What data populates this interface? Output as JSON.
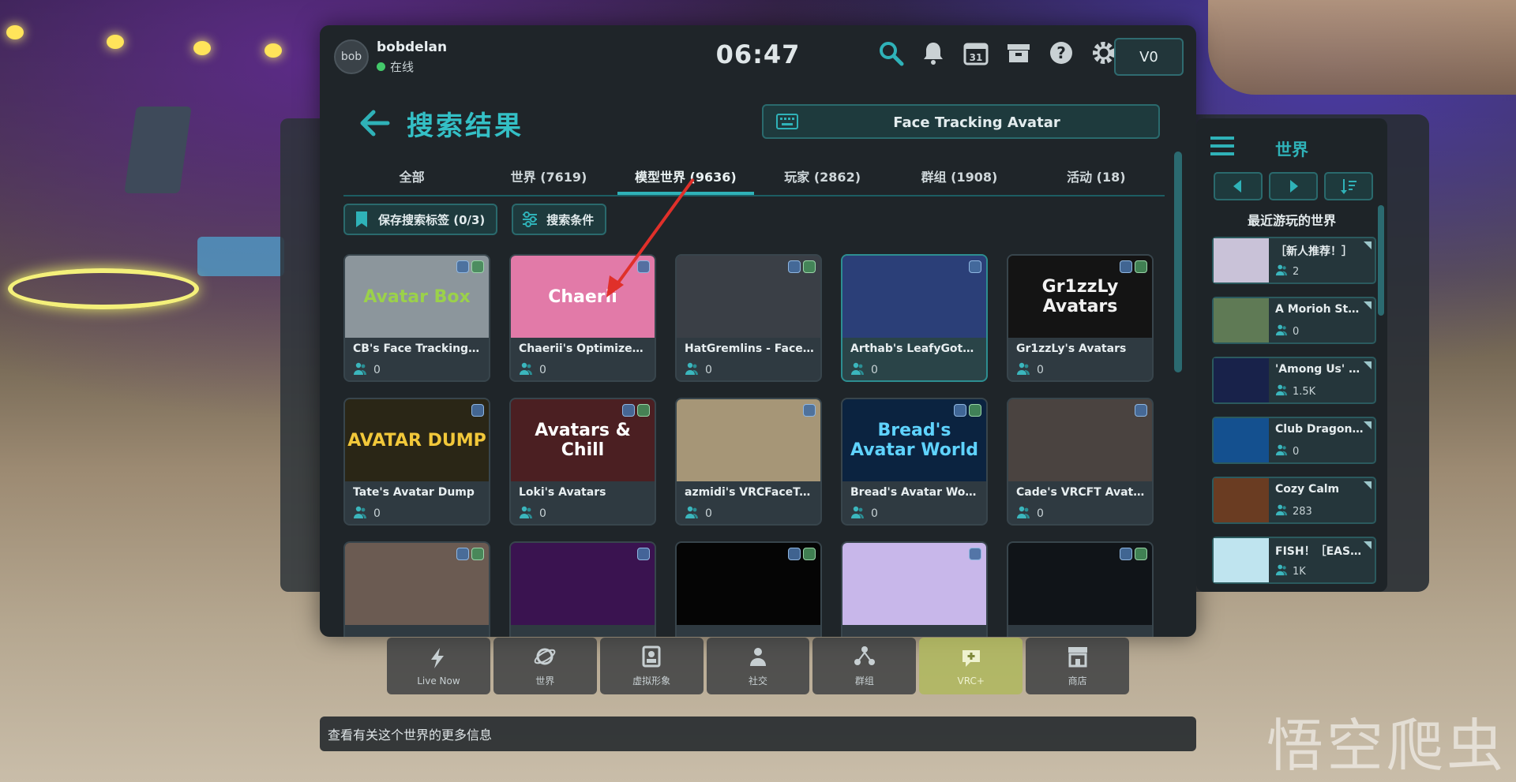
{
  "user": {
    "avatar_initials": "bob",
    "name": "bobdelan",
    "status": "在线"
  },
  "clock": "06:47",
  "credits": "V0",
  "header": {
    "title": "搜索结果",
    "search_value": "Face Tracking Avatar"
  },
  "tabs": [
    {
      "label": "全部"
    },
    {
      "label": "世界 (7619)"
    },
    {
      "label": "模型世界 (9636)"
    },
    {
      "label": "玩家 (2862)"
    },
    {
      "label": "群组 (1908)"
    },
    {
      "label": "活动 (18)"
    }
  ],
  "filters": {
    "save_tags": "保存搜索标签 (0/3)",
    "search_conditions": "搜索条件"
  },
  "results": [
    {
      "thumb_text": "Avatar Box",
      "name": "CB's Face Tracking Av...",
      "count": "0",
      "bg": "#8c969c",
      "fg": "#9bd14a"
    },
    {
      "thumb_text": "Chaerii",
      "name": "Chaerii's Optimized ...",
      "count": "0",
      "bg": "#e27aa8",
      "fg": "#ffffff"
    },
    {
      "thumb_text": "",
      "name": "HatGremlins - Face Tr...",
      "count": "0",
      "bg": "#3a3f46",
      "fg": "#ffffff"
    },
    {
      "thumb_text": "",
      "name": "Arthab's LeafyGote A...",
      "count": "0",
      "bg": "#2b3f78",
      "fg": "#ffffff"
    },
    {
      "thumb_text": "Gr1zzLy Avatars",
      "name": "Gr1zzLy's Avatars",
      "count": "0",
      "bg": "#141414",
      "fg": "#f1f1f1"
    },
    {
      "thumb_text": "AVATAR DUMP",
      "name": "Tate's Avatar Dump",
      "count": "0",
      "bg": "#2a2616",
      "fg": "#f2c83a"
    },
    {
      "thumb_text": "Avatars & Chill",
      "name": "Loki's Avatars",
      "count": "0",
      "bg": "#4b1f22",
      "fg": "#ffffff"
    },
    {
      "thumb_text": "",
      "name": "azmidi's VRCFaceTrac...",
      "count": "0",
      "bg": "#a69677",
      "fg": "#ffffff"
    },
    {
      "thumb_text": "Bread's Avatar World",
      "name": "Bread's Avatar World",
      "count": "0",
      "bg": "#0b2340",
      "fg": "#5fd3ff"
    },
    {
      "thumb_text": "",
      "name": "Cade's VRCFT Avatars",
      "count": "0",
      "bg": "#4a4340",
      "fg": "#ffffff"
    },
    {
      "thumb_text": "",
      "name": "",
      "count": "",
      "bg": "#6b5b52",
      "fg": "#ffffff"
    },
    {
      "thumb_text": "",
      "name": "",
      "count": "",
      "bg": "#3a1350",
      "fg": "#ff66cc"
    },
    {
      "thumb_text": "",
      "name": "",
      "count": "",
      "bg": "#050505",
      "fg": "#ffffff"
    },
    {
      "thumb_text": "",
      "name": "",
      "count": "",
      "bg": "#c8b7ea",
      "fg": "#ffffff"
    },
    {
      "thumb_text": "",
      "name": "",
      "count": "",
      "bg": "#101418",
      "fg": "#ffffff"
    }
  ],
  "sidebar": {
    "title": "世界",
    "subtitle": "最近游玩的世界",
    "items": [
      {
        "name": "［新人推荐！］",
        "count": "2",
        "bg": "#c9c2d8"
      },
      {
        "name": "A Morioh Stati...",
        "count": "0",
        "bg": "#5f7a55"
      },
      {
        "name": "'Among Us' ga...",
        "count": "1.5K",
        "bg": "#18224a"
      },
      {
        "name": "Club Dragon 1...",
        "count": "0",
        "bg": "#14508f"
      },
      {
        "name": "Cozy Calm",
        "count": "283",
        "bg": "#6a3c22"
      },
      {
        "name": "FISH！［EAST...",
        "count": "1K",
        "bg": "#bfe4ef"
      }
    ]
  },
  "dock": [
    {
      "label": "Live Now",
      "icon": "lightning-icon"
    },
    {
      "label": "世界",
      "icon": "planet-icon"
    },
    {
      "label": "虚拟形象",
      "icon": "avatar-icon"
    },
    {
      "label": "社交",
      "icon": "social-icon"
    },
    {
      "label": "群组",
      "icon": "groups-icon"
    },
    {
      "label": "VRC+",
      "icon": "vrcplus-icon"
    },
    {
      "label": "商店",
      "icon": "store-icon"
    }
  ],
  "infobar": "查看有关这个世界的更多信息",
  "watermark": "悟空爬虫",
  "colors": {
    "accent": "#2fb2b8",
    "panel": "#1f2529",
    "active_dock": "#afb95a"
  }
}
